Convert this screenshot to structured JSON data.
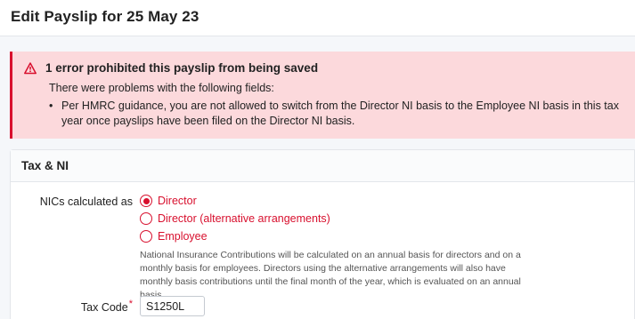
{
  "header": {
    "title": "Edit Payslip for 25 May 23"
  },
  "error": {
    "title": "1 error prohibited this payslip from being saved",
    "subtitle": "There were problems with the following fields:",
    "items": [
      "Per HMRC guidance, you are not allowed to switch from the Director NI basis to the Employee NI basis in this tax year once payslips have been filed on the Director NI basis."
    ]
  },
  "tax_ni": {
    "section_title": "Tax & NI",
    "nics_label": "NICs calculated as",
    "options": [
      {
        "label": "Director",
        "selected": true
      },
      {
        "label": "Director (alternative arrangements)",
        "selected": false
      },
      {
        "label": "Employee",
        "selected": false
      }
    ],
    "help_text": "National Insurance Contributions will be calculated on an annual basis for directors and on a monthly basis for employees. Directors using the alternative arrangements will also have monthly basis contributions until the final month of the year, which is evaluated on an annual basis.",
    "tax_code_label": "Tax Code",
    "required_mark": "*",
    "tax_code_value": "S1250L"
  },
  "colors": {
    "accent": "#d8102e",
    "error_bg": "#fcd9dc"
  }
}
